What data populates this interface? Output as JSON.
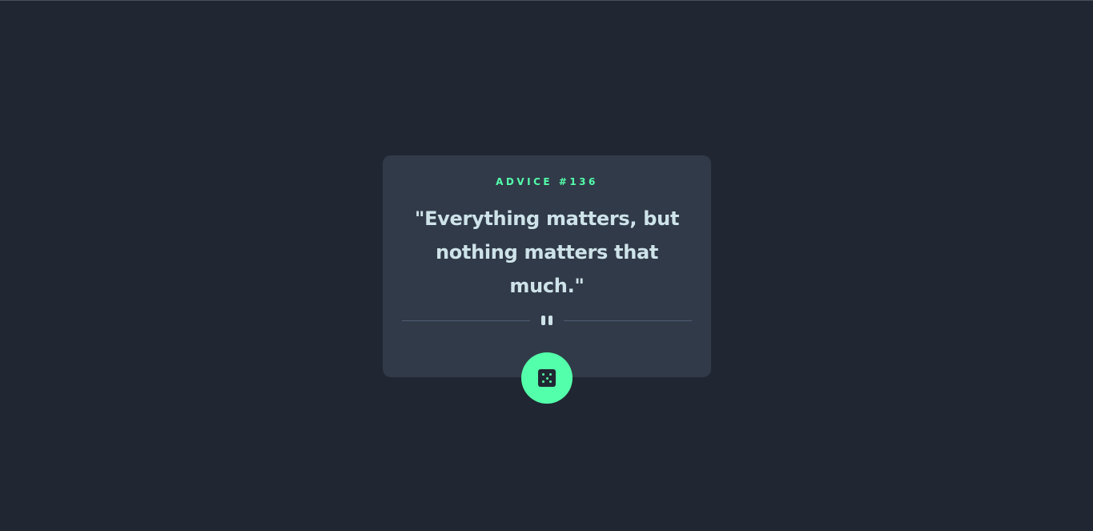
{
  "advice": {
    "id_label": "ADVICE #136",
    "quote": "\"Everything matters, but nothing matters that much.\""
  },
  "icons": {
    "divider": "pause-icon",
    "button": "dice-icon"
  },
  "colors": {
    "background": "#202632",
    "card": "#313a49",
    "accent": "#53ffaa",
    "text": "#cee3e9",
    "divider": "#4f5d74"
  }
}
